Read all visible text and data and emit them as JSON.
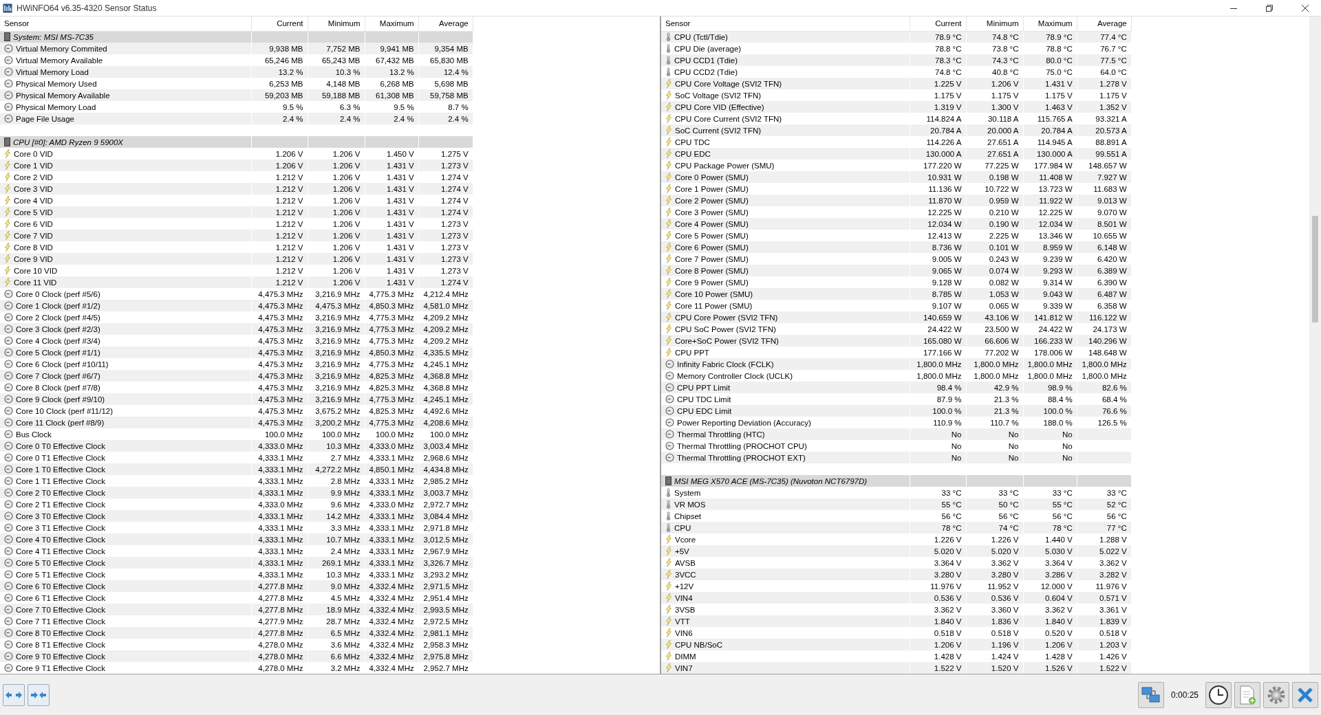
{
  "window": {
    "title": "HWiNFO64 v6.35-4320 Sensor Status"
  },
  "panels": [
    {
      "columns": [
        "Sensor",
        "Current",
        "Minimum",
        "Maximum",
        "Average"
      ],
      "rows": [
        {
          "kind": "group",
          "name": "System: MSI MS-7C35"
        },
        {
          "kind": "clock",
          "name": "Virtual Memory Commited",
          "values": [
            "9,938 MB",
            "7,752 MB",
            "9,941 MB",
            "9,354 MB"
          ]
        },
        {
          "kind": "clock",
          "name": "Virtual Memory Available",
          "values": [
            "65,246 MB",
            "65,243 MB",
            "67,432 MB",
            "65,830 MB"
          ]
        },
        {
          "kind": "clock",
          "name": "Virtual Memory Load",
          "values": [
            "13.2 %",
            "10.3 %",
            "13.2 %",
            "12.4 %"
          ]
        },
        {
          "kind": "clock",
          "name": "Physical Memory Used",
          "values": [
            "6,253 MB",
            "4,148 MB",
            "6,268 MB",
            "5,698 MB"
          ]
        },
        {
          "kind": "clock",
          "name": "Physical Memory Available",
          "values": [
            "59,203 MB",
            "59,188 MB",
            "61,308 MB",
            "59,758 MB"
          ]
        },
        {
          "kind": "clock",
          "name": "Physical Memory Load",
          "values": [
            "9.5 %",
            "6.3 %",
            "9.5 %",
            "8.7 %"
          ]
        },
        {
          "kind": "clock",
          "name": "Page File Usage",
          "values": [
            "2.4 %",
            "2.4 %",
            "2.4 %",
            "2.4 %"
          ]
        },
        {
          "kind": "blank"
        },
        {
          "kind": "group",
          "name": "CPU [#0]: AMD Ryzen 9 5900X"
        },
        {
          "kind": "bolt",
          "name": "Core 0 VID",
          "values": [
            "1.206 V",
            "1.206 V",
            "1.450 V",
            "1.275 V"
          ]
        },
        {
          "kind": "bolt",
          "name": "Core 1 VID",
          "values": [
            "1.206 V",
            "1.206 V",
            "1.431 V",
            "1.273 V"
          ]
        },
        {
          "kind": "bolt",
          "name": "Core 2 VID",
          "values": [
            "1.212 V",
            "1.206 V",
            "1.431 V",
            "1.274 V"
          ]
        },
        {
          "kind": "bolt",
          "name": "Core 3 VID",
          "values": [
            "1.212 V",
            "1.206 V",
            "1.431 V",
            "1.274 V"
          ]
        },
        {
          "kind": "bolt",
          "name": "Core 4 VID",
          "values": [
            "1.212 V",
            "1.206 V",
            "1.431 V",
            "1.274 V"
          ]
        },
        {
          "kind": "bolt",
          "name": "Core 5 VID",
          "values": [
            "1.212 V",
            "1.206 V",
            "1.431 V",
            "1.274 V"
          ]
        },
        {
          "kind": "bolt",
          "name": "Core 6 VID",
          "values": [
            "1.212 V",
            "1.206 V",
            "1.431 V",
            "1.273 V"
          ]
        },
        {
          "kind": "bolt",
          "name": "Core 7 VID",
          "values": [
            "1.212 V",
            "1.206 V",
            "1.431 V",
            "1.273 V"
          ]
        },
        {
          "kind": "bolt",
          "name": "Core 8 VID",
          "values": [
            "1.212 V",
            "1.206 V",
            "1.431 V",
            "1.273 V"
          ]
        },
        {
          "kind": "bolt",
          "name": "Core 9 VID",
          "values": [
            "1.212 V",
            "1.206 V",
            "1.431 V",
            "1.273 V"
          ]
        },
        {
          "kind": "bolt",
          "name": "Core 10 VID",
          "values": [
            "1.212 V",
            "1.206 V",
            "1.431 V",
            "1.273 V"
          ]
        },
        {
          "kind": "bolt",
          "name": "Core 11 VID",
          "values": [
            "1.212 V",
            "1.206 V",
            "1.431 V",
            "1.274 V"
          ]
        },
        {
          "kind": "clock",
          "name": "Core 0 Clock (perf #5/6)",
          "values": [
            "4,475.3 MHz",
            "3,216.9 MHz",
            "4,775.3 MHz",
            "4,212.4 MHz"
          ]
        },
        {
          "kind": "clock",
          "name": "Core 1 Clock (perf #1/2)",
          "values": [
            "4,475.3 MHz",
            "4,475.3 MHz",
            "4,850.3 MHz",
            "4,581.0 MHz"
          ]
        },
        {
          "kind": "clock",
          "name": "Core 2 Clock (perf #4/5)",
          "values": [
            "4,475.3 MHz",
            "3,216.9 MHz",
            "4,775.3 MHz",
            "4,209.2 MHz"
          ]
        },
        {
          "kind": "clock",
          "name": "Core 3 Clock (perf #2/3)",
          "values": [
            "4,475.3 MHz",
            "3,216.9 MHz",
            "4,775.3 MHz",
            "4,209.2 MHz"
          ]
        },
        {
          "kind": "clock",
          "name": "Core 4 Clock (perf #3/4)",
          "values": [
            "4,475.3 MHz",
            "3,216.9 MHz",
            "4,775.3 MHz",
            "4,209.2 MHz"
          ]
        },
        {
          "kind": "clock",
          "name": "Core 5 Clock (perf #1/1)",
          "values": [
            "4,475.3 MHz",
            "3,216.9 MHz",
            "4,850.3 MHz",
            "4,335.5 MHz"
          ]
        },
        {
          "kind": "clock",
          "name": "Core 6 Clock (perf #10/11)",
          "values": [
            "4,475.3 MHz",
            "3,216.9 MHz",
            "4,775.3 MHz",
            "4,245.1 MHz"
          ]
        },
        {
          "kind": "clock",
          "name": "Core 7 Clock (perf #6/7)",
          "values": [
            "4,475.3 MHz",
            "3,216.9 MHz",
            "4,825.3 MHz",
            "4,368.8 MHz"
          ]
        },
        {
          "kind": "clock",
          "name": "Core 8 Clock (perf #7/8)",
          "values": [
            "4,475.3 MHz",
            "3,216.9 MHz",
            "4,825.3 MHz",
            "4,368.8 MHz"
          ]
        },
        {
          "kind": "clock",
          "name": "Core 9 Clock (perf #9/10)",
          "values": [
            "4,475.3 MHz",
            "3,216.9 MHz",
            "4,775.3 MHz",
            "4,245.1 MHz"
          ]
        },
        {
          "kind": "clock",
          "name": "Core 10 Clock (perf #11/12)",
          "values": [
            "4,475.3 MHz",
            "3,675.2 MHz",
            "4,825.3 MHz",
            "4,492.6 MHz"
          ]
        },
        {
          "kind": "clock",
          "name": "Core 11 Clock (perf #8/9)",
          "values": [
            "4,475.3 MHz",
            "3,200.2 MHz",
            "4,775.3 MHz",
            "4,208.6 MHz"
          ]
        },
        {
          "kind": "clock",
          "name": "Bus Clock",
          "values": [
            "100.0 MHz",
            "100.0 MHz",
            "100.0 MHz",
            "100.0 MHz"
          ]
        },
        {
          "kind": "clock",
          "name": "Core 0 T0 Effective Clock",
          "values": [
            "4,333.0 MHz",
            "10.3 MHz",
            "4,333.0 MHz",
            "3,003.4 MHz"
          ]
        },
        {
          "kind": "clock",
          "name": "Core 0 T1 Effective Clock",
          "values": [
            "4,333.1 MHz",
            "2.7 MHz",
            "4,333.1 MHz",
            "2,968.6 MHz"
          ]
        },
        {
          "kind": "clock",
          "name": "Core 1 T0 Effective Clock",
          "values": [
            "4,333.1 MHz",
            "4,272.2 MHz",
            "4,850.1 MHz",
            "4,434.8 MHz"
          ]
        },
        {
          "kind": "clock",
          "name": "Core 1 T1 Effective Clock",
          "values": [
            "4,333.1 MHz",
            "2.8 MHz",
            "4,333.1 MHz",
            "2,985.2 MHz"
          ]
        },
        {
          "kind": "clock",
          "name": "Core 2 T0 Effective Clock",
          "values": [
            "4,333.1 MHz",
            "9.9 MHz",
            "4,333.1 MHz",
            "3,003.7 MHz"
          ]
        },
        {
          "kind": "clock",
          "name": "Core 2 T1 Effective Clock",
          "values": [
            "4,333.0 MHz",
            "9.6 MHz",
            "4,333.0 MHz",
            "2,972.7 MHz"
          ]
        },
        {
          "kind": "clock",
          "name": "Core 3 T0 Effective Clock",
          "values": [
            "4,333.1 MHz",
            "14.2 MHz",
            "4,333.1 MHz",
            "3,084.4 MHz"
          ]
        },
        {
          "kind": "clock",
          "name": "Core 3 T1 Effective Clock",
          "values": [
            "4,333.1 MHz",
            "3.3 MHz",
            "4,333.1 MHz",
            "2,971.8 MHz"
          ]
        },
        {
          "kind": "clock",
          "name": "Core 4 T0 Effective Clock",
          "values": [
            "4,333.1 MHz",
            "10.7 MHz",
            "4,333.1 MHz",
            "3,012.5 MHz"
          ]
        },
        {
          "kind": "clock",
          "name": "Core 4 T1 Effective Clock",
          "values": [
            "4,333.1 MHz",
            "2.4 MHz",
            "4,333.1 MHz",
            "2,967.9 MHz"
          ]
        },
        {
          "kind": "clock",
          "name": "Core 5 T0 Effective Clock",
          "values": [
            "4,333.1 MHz",
            "269.1 MHz",
            "4,333.1 MHz",
            "3,326.7 MHz"
          ]
        },
        {
          "kind": "clock",
          "name": "Core 5 T1 Effective Clock",
          "values": [
            "4,333.1 MHz",
            "10.3 MHz",
            "4,333.1 MHz",
            "3,293.2 MHz"
          ]
        },
        {
          "kind": "clock",
          "name": "Core 6 T0 Effective Clock",
          "values": [
            "4,277.8 MHz",
            "9.0 MHz",
            "4,332.4 MHz",
            "2,971.5 MHz"
          ]
        },
        {
          "kind": "clock",
          "name": "Core 6 T1 Effective Clock",
          "values": [
            "4,277.8 MHz",
            "4.5 MHz",
            "4,332.4 MHz",
            "2,951.4 MHz"
          ]
        },
        {
          "kind": "clock",
          "name": "Core 7 T0 Effective Clock",
          "values": [
            "4,277.8 MHz",
            "18.9 MHz",
            "4,332.4 MHz",
            "2,993.5 MHz"
          ]
        },
        {
          "kind": "clock",
          "name": "Core 7 T1 Effective Clock",
          "values": [
            "4,277.9 MHz",
            "28.7 MHz",
            "4,332.4 MHz",
            "2,972.5 MHz"
          ]
        },
        {
          "kind": "clock",
          "name": "Core 8 T0 Effective Clock",
          "values": [
            "4,277.8 MHz",
            "6.5 MHz",
            "4,332.4 MHz",
            "2,981.1 MHz"
          ]
        },
        {
          "kind": "clock",
          "name": "Core 8 T1 Effective Clock",
          "values": [
            "4,278.0 MHz",
            "3.6 MHz",
            "4,332.4 MHz",
            "2,958.3 MHz"
          ]
        },
        {
          "kind": "clock",
          "name": "Core 9 T0 Effective Clock",
          "values": [
            "4,278.0 MHz",
            "6.6 MHz",
            "4,332.4 MHz",
            "2,975.8 MHz"
          ]
        },
        {
          "kind": "clock",
          "name": "Core 9 T1 Effective Clock",
          "values": [
            "4,278.0 MHz",
            "3.2 MHz",
            "4,332.4 MHz",
            "2,952.7 MHz"
          ]
        }
      ]
    },
    {
      "columns": [
        "Sensor",
        "Current",
        "Minimum",
        "Maximum",
        "Average"
      ],
      "rows": [
        {
          "kind": "thermo",
          "name": "CPU (Tctl/Tdie)",
          "values": [
            "78.9 °C",
            "74.8 °C",
            "78.9 °C",
            "77.4 °C"
          ]
        },
        {
          "kind": "thermo",
          "name": "CPU Die (average)",
          "values": [
            "78.8 °C",
            "73.8 °C",
            "78.8 °C",
            "76.7 °C"
          ]
        },
        {
          "kind": "thermo",
          "name": "CPU CCD1 (Tdie)",
          "values": [
            "78.3 °C",
            "74.3 °C",
            "80.0 °C",
            "77.5 °C"
          ]
        },
        {
          "kind": "thermo",
          "name": "CPU CCD2 (Tdie)",
          "values": [
            "74.8 °C",
            "40.8 °C",
            "75.0 °C",
            "64.0 °C"
          ]
        },
        {
          "kind": "bolt",
          "name": "CPU Core Voltage (SVI2 TFN)",
          "values": [
            "1.225 V",
            "1.206 V",
            "1.431 V",
            "1.278 V"
          ]
        },
        {
          "kind": "bolt",
          "name": "SoC Voltage (SVI2 TFN)",
          "values": [
            "1.175 V",
            "1.175 V",
            "1.175 V",
            "1.175 V"
          ]
        },
        {
          "kind": "bolt",
          "name": "CPU Core VID (Effective)",
          "values": [
            "1.319 V",
            "1.300 V",
            "1.463 V",
            "1.352 V"
          ]
        },
        {
          "kind": "bolt",
          "name": "CPU Core Current (SVI2 TFN)",
          "values": [
            "114.824 A",
            "30.118 A",
            "115.765 A",
            "93.321 A"
          ]
        },
        {
          "kind": "bolt",
          "name": "SoC Current (SVI2 TFN)",
          "values": [
            "20.784 A",
            "20.000 A",
            "20.784 A",
            "20.573 A"
          ]
        },
        {
          "kind": "bolt",
          "name": "CPU TDC",
          "values": [
            "114.226 A",
            "27.651 A",
            "114.945 A",
            "88.891 A"
          ]
        },
        {
          "kind": "bolt",
          "name": "CPU EDC",
          "values": [
            "130.000 A",
            "27.651 A",
            "130.000 A",
            "99.551 A"
          ]
        },
        {
          "kind": "bolt",
          "name": "CPU Package Power (SMU)",
          "values": [
            "177.220 W",
            "77.225 W",
            "177.984 W",
            "148.657 W"
          ]
        },
        {
          "kind": "bolt",
          "name": "Core 0 Power (SMU)",
          "values": [
            "10.931 W",
            "0.198 W",
            "11.408 W",
            "7.927 W"
          ]
        },
        {
          "kind": "bolt",
          "name": "Core 1 Power (SMU)",
          "values": [
            "11.136 W",
            "10.722 W",
            "13.723 W",
            "11.683 W"
          ]
        },
        {
          "kind": "bolt",
          "name": "Core 2 Power (SMU)",
          "values": [
            "11.870 W",
            "0.959 W",
            "11.922 W",
            "9.013 W"
          ]
        },
        {
          "kind": "bolt",
          "name": "Core 3 Power (SMU)",
          "values": [
            "12.225 W",
            "0.210 W",
            "12.225 W",
            "9.070 W"
          ]
        },
        {
          "kind": "bolt",
          "name": "Core 4 Power (SMU)",
          "values": [
            "12.034 W",
            "0.190 W",
            "12.034 W",
            "8.501 W"
          ]
        },
        {
          "kind": "bolt",
          "name": "Core 5 Power (SMU)",
          "values": [
            "12.413 W",
            "2.225 W",
            "13.346 W",
            "10.655 W"
          ]
        },
        {
          "kind": "bolt",
          "name": "Core 6 Power (SMU)",
          "values": [
            "8.736 W",
            "0.101 W",
            "8.959 W",
            "6.148 W"
          ]
        },
        {
          "kind": "bolt",
          "name": "Core 7 Power (SMU)",
          "values": [
            "9.005 W",
            "0.243 W",
            "9.239 W",
            "6.420 W"
          ]
        },
        {
          "kind": "bolt",
          "name": "Core 8 Power (SMU)",
          "values": [
            "9.065 W",
            "0.074 W",
            "9.293 W",
            "6.389 W"
          ]
        },
        {
          "kind": "bolt",
          "name": "Core 9 Power (SMU)",
          "values": [
            "9.128 W",
            "0.082 W",
            "9.314 W",
            "6.390 W"
          ]
        },
        {
          "kind": "bolt",
          "name": "Core 10 Power (SMU)",
          "values": [
            "8.785 W",
            "1.053 W",
            "9.043 W",
            "6.487 W"
          ]
        },
        {
          "kind": "bolt",
          "name": "Core 11 Power (SMU)",
          "values": [
            "9.107 W",
            "0.065 W",
            "9.339 W",
            "6.358 W"
          ]
        },
        {
          "kind": "bolt",
          "name": "CPU Core Power (SVI2 TFN)",
          "values": [
            "140.659 W",
            "43.106 W",
            "141.812 W",
            "116.122 W"
          ]
        },
        {
          "kind": "bolt",
          "name": "CPU SoC Power (SVI2 TFN)",
          "values": [
            "24.422 W",
            "23.500 W",
            "24.422 W",
            "24.173 W"
          ]
        },
        {
          "kind": "bolt",
          "name": "Core+SoC Power (SVI2 TFN)",
          "values": [
            "165.080 W",
            "66.606 W",
            "166.233 W",
            "140.296 W"
          ]
        },
        {
          "kind": "bolt",
          "name": "CPU PPT",
          "values": [
            "177.166 W",
            "77.202 W",
            "178.006 W",
            "148.648 W"
          ]
        },
        {
          "kind": "clock",
          "name": "Infinity Fabric Clock (FCLK)",
          "values": [
            "1,800.0 MHz",
            "1,800.0 MHz",
            "1,800.0 MHz",
            "1,800.0 MHz"
          ]
        },
        {
          "kind": "clock",
          "name": "Memory Controller Clock (UCLK)",
          "values": [
            "1,800.0 MHz",
            "1,800.0 MHz",
            "1,800.0 MHz",
            "1,800.0 MHz"
          ]
        },
        {
          "kind": "clock",
          "name": "CPU PPT Limit",
          "values": [
            "98.4 %",
            "42.9 %",
            "98.9 %",
            "82.6 %"
          ]
        },
        {
          "kind": "clock",
          "name": "CPU TDC Limit",
          "values": [
            "87.9 %",
            "21.3 %",
            "88.4 %",
            "68.4 %"
          ]
        },
        {
          "kind": "clock",
          "name": "CPU EDC Limit",
          "values": [
            "100.0 %",
            "21.3 %",
            "100.0 %",
            "76.6 %"
          ]
        },
        {
          "kind": "clock",
          "name": "Power Reporting Deviation (Accuracy)",
          "values": [
            "110.9 %",
            "110.7 %",
            "188.0 %",
            "126.5 %"
          ]
        },
        {
          "kind": "clock",
          "name": "Thermal Throttling (HTC)",
          "values": [
            "No",
            "No",
            "No"
          ]
        },
        {
          "kind": "clock",
          "name": "Thermal Throttling (PROCHOT CPU)",
          "values": [
            "No",
            "No",
            "No"
          ]
        },
        {
          "kind": "clock",
          "name": "Thermal Throttling (PROCHOT EXT)",
          "values": [
            "No",
            "No",
            "No"
          ]
        },
        {
          "kind": "blank"
        },
        {
          "kind": "group",
          "name": "MSI MEG X570 ACE (MS-7C35) (Nuvoton NCT6797D)"
        },
        {
          "kind": "thermo",
          "name": "System",
          "values": [
            "33 °C",
            "33 °C",
            "33 °C",
            "33 °C"
          ]
        },
        {
          "kind": "thermo",
          "name": "VR MOS",
          "values": [
            "55 °C",
            "50 °C",
            "55 °C",
            "52 °C"
          ]
        },
        {
          "kind": "thermo",
          "name": "Chipset",
          "values": [
            "56 °C",
            "56 °C",
            "56 °C",
            "56 °C"
          ]
        },
        {
          "kind": "thermo",
          "name": "CPU",
          "values": [
            "78 °C",
            "74 °C",
            "78 °C",
            "77 °C"
          ]
        },
        {
          "kind": "bolt",
          "name": "Vcore",
          "values": [
            "1.226 V",
            "1.226 V",
            "1.440 V",
            "1.288 V"
          ]
        },
        {
          "kind": "bolt",
          "name": "+5V",
          "values": [
            "5.020 V",
            "5.020 V",
            "5.030 V",
            "5.022 V"
          ]
        },
        {
          "kind": "bolt",
          "name": "AVSB",
          "values": [
            "3.364 V",
            "3.362 V",
            "3.364 V",
            "3.362 V"
          ]
        },
        {
          "kind": "bolt",
          "name": "3VCC",
          "values": [
            "3.280 V",
            "3.280 V",
            "3.286 V",
            "3.282 V"
          ]
        },
        {
          "kind": "bolt",
          "name": "+12V",
          "values": [
            "11.976 V",
            "11.952 V",
            "12.000 V",
            "11.976 V"
          ]
        },
        {
          "kind": "bolt",
          "name": "VIN4",
          "values": [
            "0.536 V",
            "0.536 V",
            "0.604 V",
            "0.571 V"
          ]
        },
        {
          "kind": "bolt",
          "name": "3VSB",
          "values": [
            "3.362 V",
            "3.360 V",
            "3.362 V",
            "3.361 V"
          ]
        },
        {
          "kind": "bolt",
          "name": "VTT",
          "values": [
            "1.840 V",
            "1.836 V",
            "1.840 V",
            "1.839 V"
          ]
        },
        {
          "kind": "bolt",
          "name": "VIN6",
          "values": [
            "0.518 V",
            "0.518 V",
            "0.520 V",
            "0.518 V"
          ]
        },
        {
          "kind": "bolt",
          "name": "CPU NB/SoC",
          "values": [
            "1.206 V",
            "1.196 V",
            "1.206 V",
            "1.203 V"
          ]
        },
        {
          "kind": "bolt",
          "name": "DIMM",
          "values": [
            "1.428 V",
            "1.424 V",
            "1.428 V",
            "1.426 V"
          ]
        },
        {
          "kind": "bolt",
          "name": "VIN7",
          "values": [
            "1.522 V",
            "1.520 V",
            "1.526 V",
            "1.522 V"
          ]
        }
      ]
    }
  ],
  "toolbar": {
    "elapsed": "0:00:25"
  }
}
